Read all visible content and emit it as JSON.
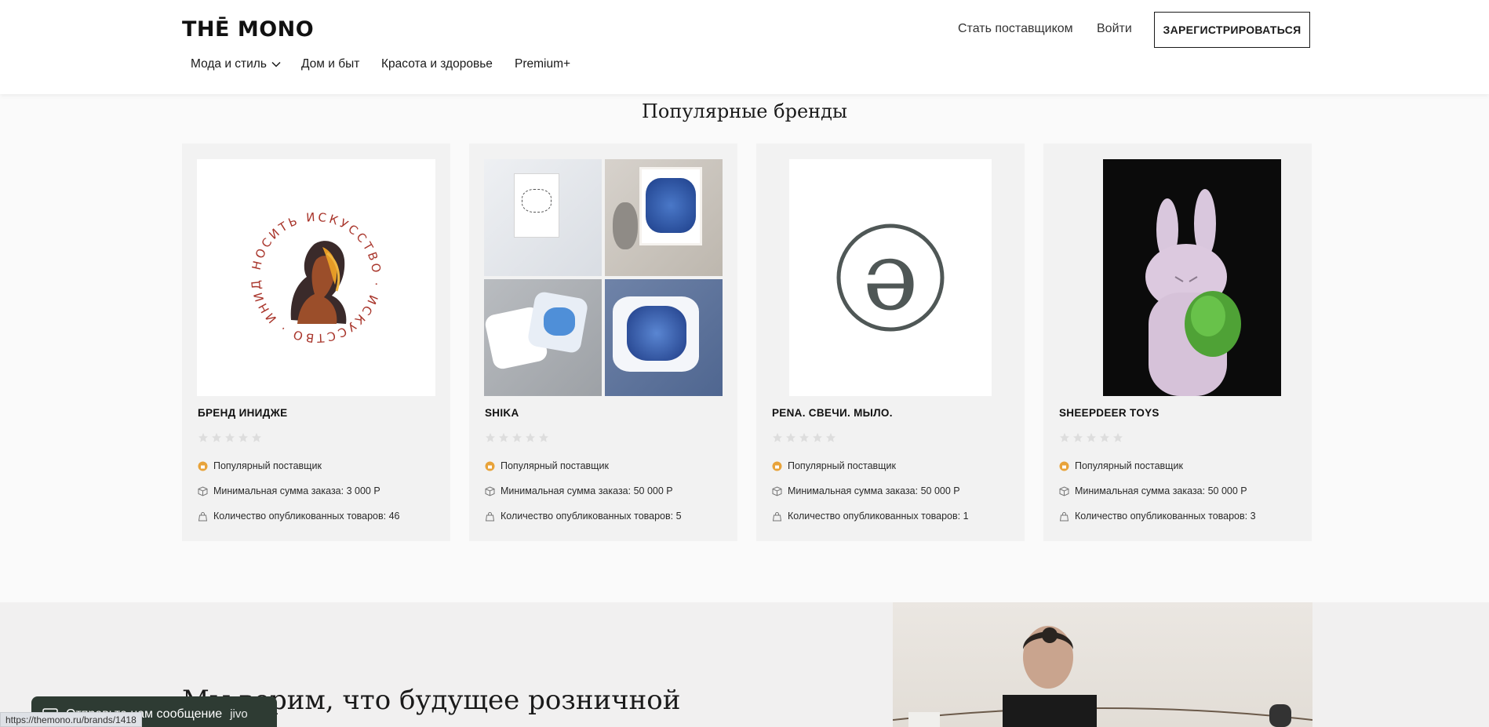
{
  "header": {
    "logo": "THĒ MONO",
    "become_supplier": "Стать поставщиком",
    "login": "Войти",
    "register": "ЗАРЕГИСТРИРОВАТЬСЯ"
  },
  "categories": [
    {
      "label": "Мода и стиль"
    },
    {
      "label": "Дом и быт"
    },
    {
      "label": "Красота и здоровье"
    },
    {
      "label": "Premium+"
    }
  ],
  "section_title": "Популярные бренды",
  "brands": [
    {
      "name": "БРЕНД ИНИДЖЕ",
      "rating": 0,
      "badge": "Популярный поставщик",
      "min_order": "Минимальная сумма заказа: 3 000 Р",
      "published": "Количество опубликованных товаров: 46",
      "logo_ring_text": "НОСИТЬ ИСКУССТВО · ИСКУССТВО · ИНИДЖЕ"
    },
    {
      "name": "SHIKA",
      "rating": 0,
      "badge": "Популярный поставщик",
      "min_order": "Минимальная сумма заказа: 50 000 Р",
      "published": "Количество опубликованных товаров: 5"
    },
    {
      "name": "PENA. СВЕЧИ. МЫЛО.",
      "rating": 0,
      "badge": "Популярный поставщик",
      "min_order": "Минимальная сумма заказа: 50 000 Р",
      "published": "Количество опубликованных товаров: 1",
      "logo_glyph": "ə"
    },
    {
      "name": "SHEEPDEER TOYS",
      "rating": 0,
      "badge": "Популярный поставщик",
      "min_order": "Минимальная сумма заказа: 50 000 Р",
      "published": "Количество опубликованных товаров: 3"
    }
  ],
  "promo": {
    "headline": "Мы верим, что будущее розничной"
  },
  "chat": {
    "label": "Отправьте нам сообщение",
    "brand": "jivo"
  },
  "status_bar_url": "https://themono.ru/brands/1418",
  "colors": {
    "badge": "#e8a33a",
    "star_empty": "#dddddd",
    "chat_bg": "#2e3b33"
  }
}
